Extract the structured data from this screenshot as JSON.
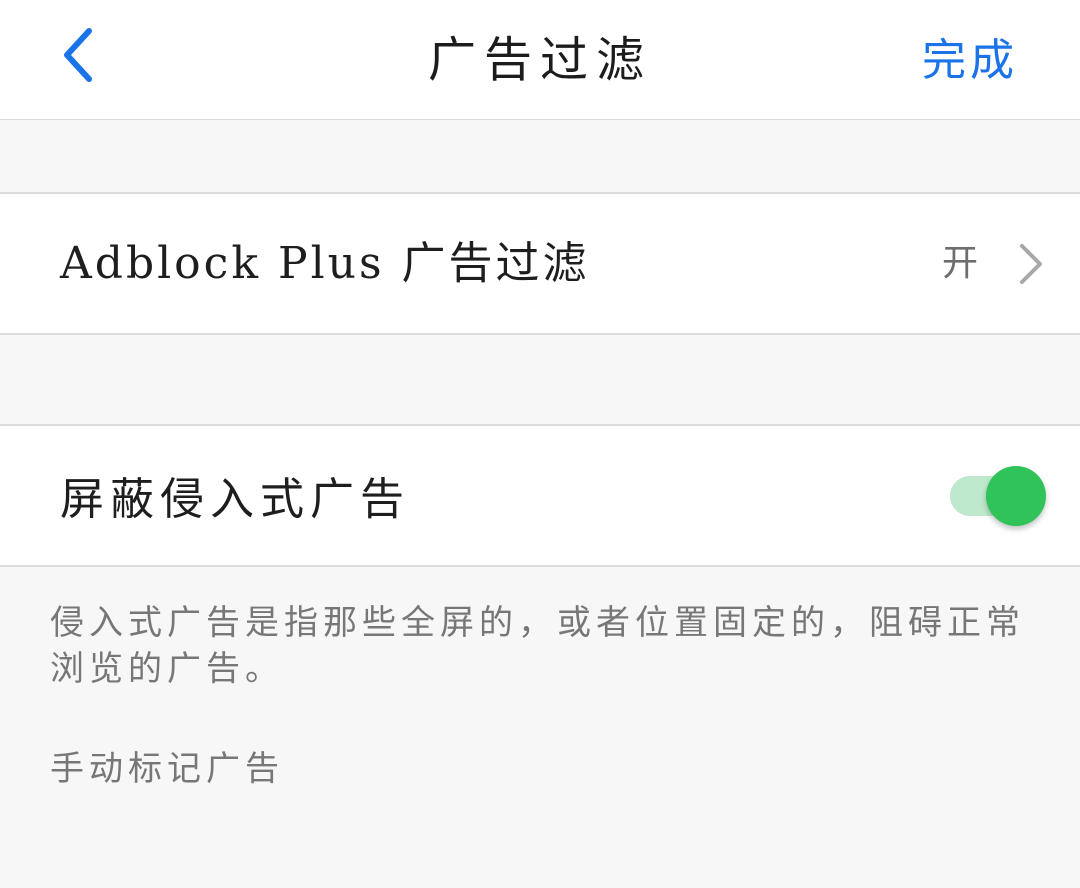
{
  "nav": {
    "title": "广告过滤",
    "done_label": "完成",
    "back_icon": "chevron-left-icon",
    "accent_color": "#1a73e8"
  },
  "settings": {
    "adblock": {
      "label": "Adblock Plus 广告过滤",
      "value": "开",
      "chevron_icon": "chevron-right-icon"
    },
    "intrusive": {
      "label": "屏蔽侵入式广告",
      "toggle_on": true,
      "toggle_color": "#2fc35a"
    }
  },
  "footer": {
    "description": "侵入式广告是指那些全屏的，或者位置固定的，阻碍正常浏览的广告。",
    "manual_mark_label": "手动标记广告"
  }
}
